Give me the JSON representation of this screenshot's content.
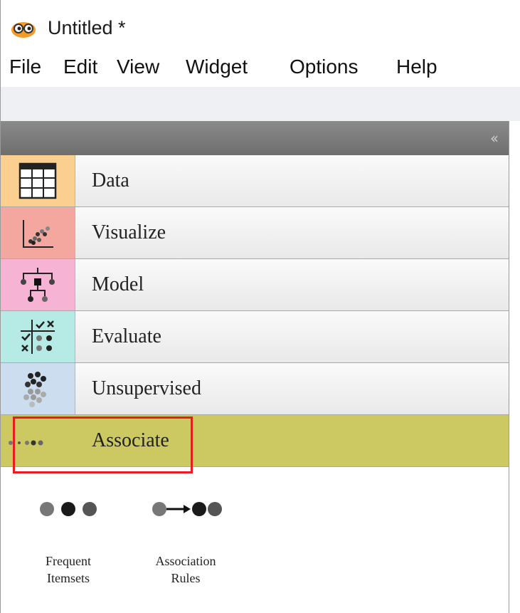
{
  "window": {
    "title": "Untitled *",
    "logo_icon": "orange-logo-with-glasses-icon"
  },
  "menu": {
    "items": [
      "File",
      "Edit",
      "View",
      "Widget",
      "Options",
      "Help"
    ]
  },
  "panel": {
    "collapse_label": "‹‹"
  },
  "categories": [
    {
      "label": "Data",
      "icon": "table-icon",
      "color": "#fbcf90"
    },
    {
      "label": "Visualize",
      "icon": "scatter-plot-icon",
      "color": "#f4a79e"
    },
    {
      "label": "Model",
      "icon": "tree-icon",
      "color": "#f6b3d3"
    },
    {
      "label": "Evaluate",
      "icon": "evaluate-grid-icon",
      "color": "#b5ebe4"
    },
    {
      "label": "Unsupervised",
      "icon": "cluster-icon",
      "color": "#cbddee"
    },
    {
      "label": "Associate",
      "icon": "dots-icon",
      "color": "#ccc862"
    }
  ],
  "widgets": [
    {
      "line1": "Frequent",
      "line2": "Itemsets",
      "icon": "three-dots-icon"
    },
    {
      "line1": "Association",
      "line2": "Rules",
      "icon": "dots-arrow-icon"
    }
  ]
}
